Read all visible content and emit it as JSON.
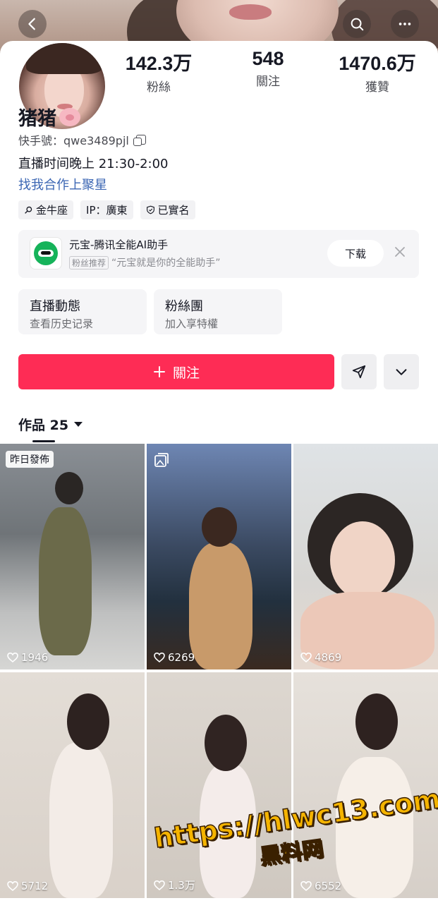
{
  "header": {
    "back_icon": "chevron-left-icon",
    "search_icon": "search-icon",
    "more_icon": "more-dots-icon"
  },
  "profile": {
    "stats": [
      {
        "value": "142.3万",
        "label": "粉絲"
      },
      {
        "value": "548",
        "label": "關注"
      },
      {
        "value": "1470.6万",
        "label": "獲贊"
      }
    ],
    "name": "猪猪",
    "id_label": "快手號：qwe3489pjl",
    "bio": "直播时间晚上 21:30-2:00",
    "link_text": "找我合作上聚星",
    "tags": [
      "金牛座",
      "IP：廣東",
      "已實名"
    ]
  },
  "ad": {
    "title": "元宝-腾讯全能AI助手",
    "badge": "粉丝推荐",
    "subtitle": "“元宝就是你的全能助手”",
    "download_label": "下载"
  },
  "features": [
    {
      "title": "直播動態",
      "subtitle": "查看历史记录"
    },
    {
      "title": "粉絲團",
      "subtitle": "加入享特權"
    }
  ],
  "actions": {
    "follow_label": "關注",
    "follow_icon": "plus-icon",
    "share_icon": "send-icon",
    "more_icon": "chevron-down-icon"
  },
  "works": {
    "label": "作品 25"
  },
  "grid": [
    {
      "likes": "1946",
      "pin": "昨日發佈"
    },
    {
      "likes": "6269",
      "multi_icon": "gallery-icon"
    },
    {
      "likes": "4869"
    },
    {
      "likes": "5712"
    },
    {
      "likes": "1.3万"
    },
    {
      "likes": "6552"
    }
  ],
  "watermark": {
    "line1": "https://hlwc13.com",
    "line2": "黑料网"
  }
}
